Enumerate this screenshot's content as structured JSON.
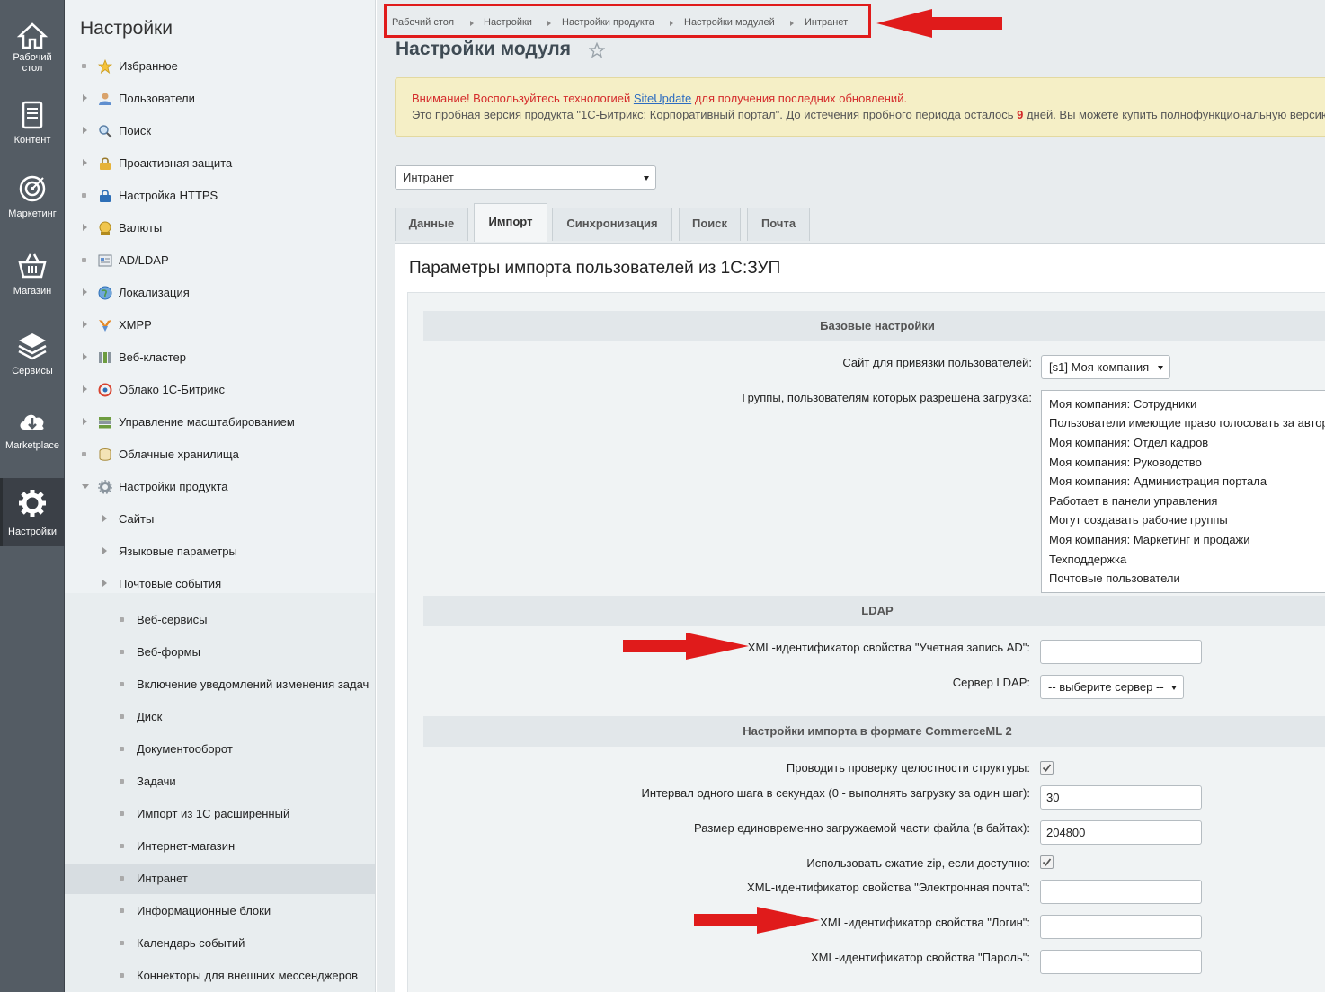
{
  "leftnav": [
    {
      "label": "Рабочий стол",
      "icon": "home-icon"
    },
    {
      "label": "Контент",
      "icon": "document-icon"
    },
    {
      "label": "Маркетинг",
      "icon": "target-icon"
    },
    {
      "label": "Магазин",
      "icon": "basket-icon"
    },
    {
      "label": "Сервисы",
      "icon": "layers-icon"
    },
    {
      "label": "Marketplace",
      "icon": "cloud-download-icon"
    },
    {
      "label": "Настройки",
      "icon": "gear-icon"
    }
  ],
  "sidebar": {
    "title": "Настройки",
    "items": [
      {
        "label": "Избранное",
        "icon": "star-icon"
      },
      {
        "label": "Пользователи",
        "icon": "user-icon"
      },
      {
        "label": "Поиск",
        "icon": "search-icon"
      },
      {
        "label": "Проактивная защита",
        "icon": "lock-icon"
      },
      {
        "label": "Настройка HTTPS",
        "icon": "https-lock-icon"
      },
      {
        "label": "Валюты",
        "icon": "coin-icon"
      },
      {
        "label": "AD/LDAP",
        "icon": "directory-icon"
      },
      {
        "label": "Локализация",
        "icon": "globe-icon"
      },
      {
        "label": "XMPP",
        "icon": "xmpp-icon"
      },
      {
        "label": "Веб-кластер",
        "icon": "cluster-icon"
      },
      {
        "label": "Облако 1С-Битрикс",
        "icon": "cloud-icon"
      },
      {
        "label": "Управление масштабированием",
        "icon": "server-icon"
      },
      {
        "label": "Облачные хранилища",
        "icon": "storage-icon"
      },
      {
        "label": "Настройки продукта",
        "icon": "gear-small-icon"
      },
      {
        "label": "Сайты"
      },
      {
        "label": "Языковые параметры"
      },
      {
        "label": "Почтовые события"
      },
      {
        "label": "Веб-сервисы"
      },
      {
        "label": "Веб-формы"
      },
      {
        "label": "Включение уведомлений изменения задач"
      },
      {
        "label": "Диск"
      },
      {
        "label": "Документооборот"
      },
      {
        "label": "Задачи"
      },
      {
        "label": "Импорт из 1С расширенный"
      },
      {
        "label": "Интернет-магазин"
      },
      {
        "label": "Интранет"
      },
      {
        "label": "Информационные блоки"
      },
      {
        "label": "Календарь событий"
      },
      {
        "label": "Коннекторы для внешних мессенджеров"
      }
    ]
  },
  "breadcrumb": [
    "Рабочий стол",
    "Настройки",
    "Настройки продукта",
    "Настройки модулей",
    "Интранет"
  ],
  "page_title": "Настройки модуля",
  "notice": {
    "l1_pre": "Внимание! Воспользуйтесь технологией ",
    "l1_link": "SiteUpdate",
    "l1_post": " для получения последних обновлений.",
    "l2_pre": "Это пробная версия продукта \"1С-Битрикс: Корпоративный портал\". До истечения пробного периода осталось ",
    "l2_days": "9",
    "l2_post": " дней. Вы можете купить полнофункциональную версию"
  },
  "site_select": "Интранет",
  "tabs": [
    "Данные",
    "Импорт",
    "Синхронизация",
    "Поиск",
    "Почта"
  ],
  "panel_title": "Параметры импорта пользователей из 1С:ЗУП",
  "sections": {
    "basic": "Базовые настройки",
    "ldap": "LDAP",
    "commerceml": "Настройки импорта в формате CommerceML 2"
  },
  "fields": {
    "site_binding_label": "Сайт для привязки пользователей:",
    "site_binding_value": "[s1] Моя компания",
    "groups_label": "Группы, пользователям которых разрешена загрузка:",
    "groups": [
      "Моя компания: Сотрудники",
      "Пользователи имеющие право голосовать за автор",
      "Моя компания: Отдел кадров",
      "Моя компания: Руководство",
      "Моя компания: Администрация портала",
      "Работает в панели управления",
      "Могут создавать рабочие группы",
      "Моя компания: Маркетинг и продажи",
      "Техподдержка",
      "Почтовые пользователи"
    ],
    "ad_label": "XML-идентификатор свойства \"Учетная запись AD\":",
    "ad_value": "",
    "ldap_server_label": "Сервер LDAP:",
    "ldap_server_value": "-- выберите сервер --",
    "integrity_label": "Проводить проверку целостности структуры:",
    "integrity_checked": true,
    "interval_label": "Интервал одного шага в секундах (0 - выполнять загрузку за один шаг):",
    "interval_value": "30",
    "chunk_label": "Размер единовременно загружаемой части файла (в байтах):",
    "chunk_value": "204800",
    "zip_label": "Использовать сжатие zip, если доступно:",
    "zip_checked": true,
    "email_label": "XML-идентификатор свойства \"Электронная почта\":",
    "email_value": "",
    "login_label": "XML-идентификатор свойства \"Логин\":",
    "login_value": "",
    "password_label": "XML-идентификатор свойства \"Пароль\":",
    "password_value": ""
  },
  "colors": {
    "annotation_red": "#e01b1b",
    "nav_bg": "#545c64",
    "notice_bg": "#f5efc6",
    "notice_warning": "#d42a2a"
  }
}
